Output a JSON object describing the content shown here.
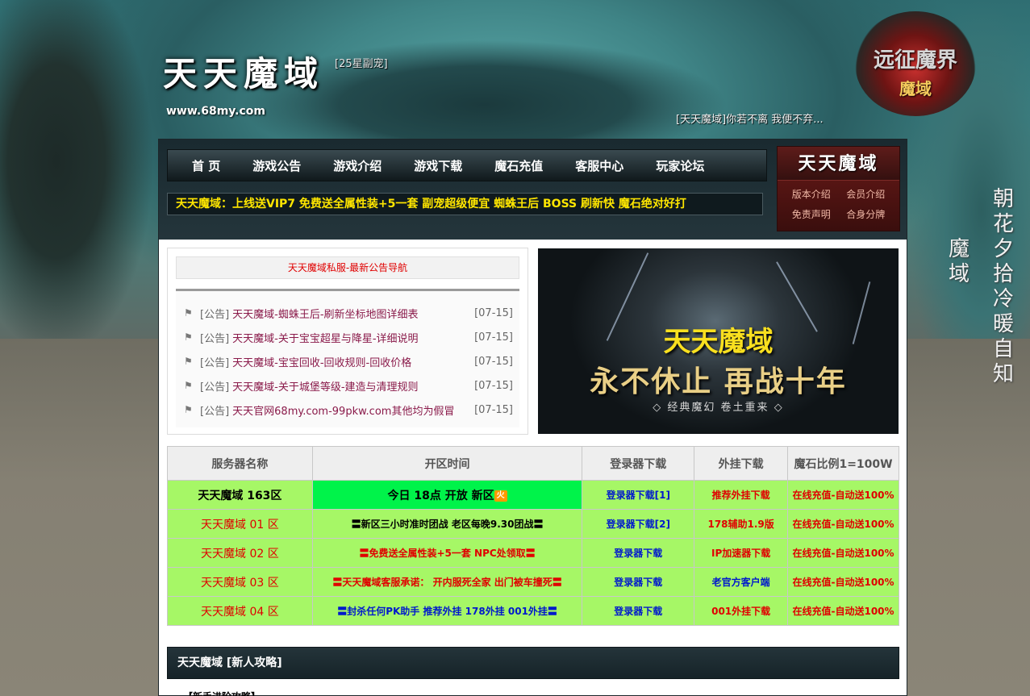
{
  "header": {
    "title": "天天魔域",
    "tag": "[25星副宠]",
    "url": "www.68my.com",
    "slogan": "[天天魔域]你若不离 我便不弃...",
    "emblem_line1": "远征魔界",
    "emblem_line2": "魔域",
    "vertical_right": "朝花夕拾冷暖自知",
    "vertical_left": "魔域"
  },
  "nav": {
    "items": [
      "首 页",
      "游戏公告",
      "游戏介绍",
      "游戏下载",
      "魔石充值",
      "客服中心",
      "玩家论坛"
    ],
    "ticker": "天天魔域：上线送VIP7 免费送全属性装+5一套 副宠超级便宜 蜘蛛王后 BOSS 刷新快 魔石绝对好打"
  },
  "side_box": {
    "title": "天天魔域",
    "links": [
      "版本介绍",
      "会员介绍",
      "免责声明",
      "合身分牌"
    ]
  },
  "notices": {
    "heading": "天天魔域私服-最新公告导航",
    "items": [
      {
        "cat": "[公告]",
        "text": "天天魔域-蜘蛛王后-刷新坐标地图详细表",
        "date": "[07-15]"
      },
      {
        "cat": "[公告]",
        "text": "天天魔域-关于宝宝超星与降星-详细说明",
        "date": "[07-15]"
      },
      {
        "cat": "[公告]",
        "text": "天天魔域-宝宝回收-回收规则-回收价格",
        "date": "[07-15]"
      },
      {
        "cat": "[公告]",
        "text": "天天魔域-关于城堡等级-建造与清理规则",
        "date": "[07-15]"
      },
      {
        "cat": "[公告]",
        "text": "天天官网68my.com-99pkw.com其他均为假冒",
        "date": "[07-15]"
      }
    ]
  },
  "banner": {
    "title": "天天魔域",
    "subtitle": "永不休止 再战十年",
    "footer": "◇ 经典魔幻 卷土重来 ◇"
  },
  "servers": {
    "headers": [
      "服务器名称",
      "开区时间",
      "登录器下载",
      "外挂下载",
      "魔石比例1=100W"
    ],
    "fire_label": "火",
    "rows": [
      {
        "name": "天天魔域 163区",
        "open": "今日 18点 开放 新区",
        "login": "登录器下载[1]",
        "plugin": "推荐外挂下载",
        "recharge": "在线充值-自动送100%"
      },
      {
        "name": "天天魔域 01 区",
        "open": "〓新区三小时准时团战 老区每晚9.30团战〓",
        "login": "登录器下载[2]",
        "plugin": "178辅助1.9版",
        "recharge": "在线充值-自动送100%"
      },
      {
        "name": "天天魔域 02 区",
        "open": "〓免费送全属性装+5一套 NPC处领取〓",
        "login": "登录器下载",
        "plugin": "IP加速器下载",
        "recharge": "在线充值-自动送100%"
      },
      {
        "name": "天天魔域 03 区",
        "open": "〓天天魔域客服承诺： 开内服死全家 出门被车撞死〓",
        "login": "登录器下载",
        "plugin": "老官方客户端",
        "recharge": "在线充值-自动送100%"
      },
      {
        "name": "天天魔域 04 区",
        "open": "〓封杀任何PK助手 推荐外挂 178外挂 001外挂〓",
        "login": "登录器下载",
        "plugin": "001外挂下载",
        "recharge": "在线充值-自动送100%"
      }
    ]
  },
  "strategy": {
    "heading": "天天魔域 [新人攻略]",
    "peek": "【新手进阶攻略】"
  },
  "colors": {
    "row_green": "#a6f766",
    "row_highlight": "#00f34a",
    "accent_red": "#e00000",
    "link_blue": "#0019cc",
    "ticker_yellow": "#ffe600"
  }
}
